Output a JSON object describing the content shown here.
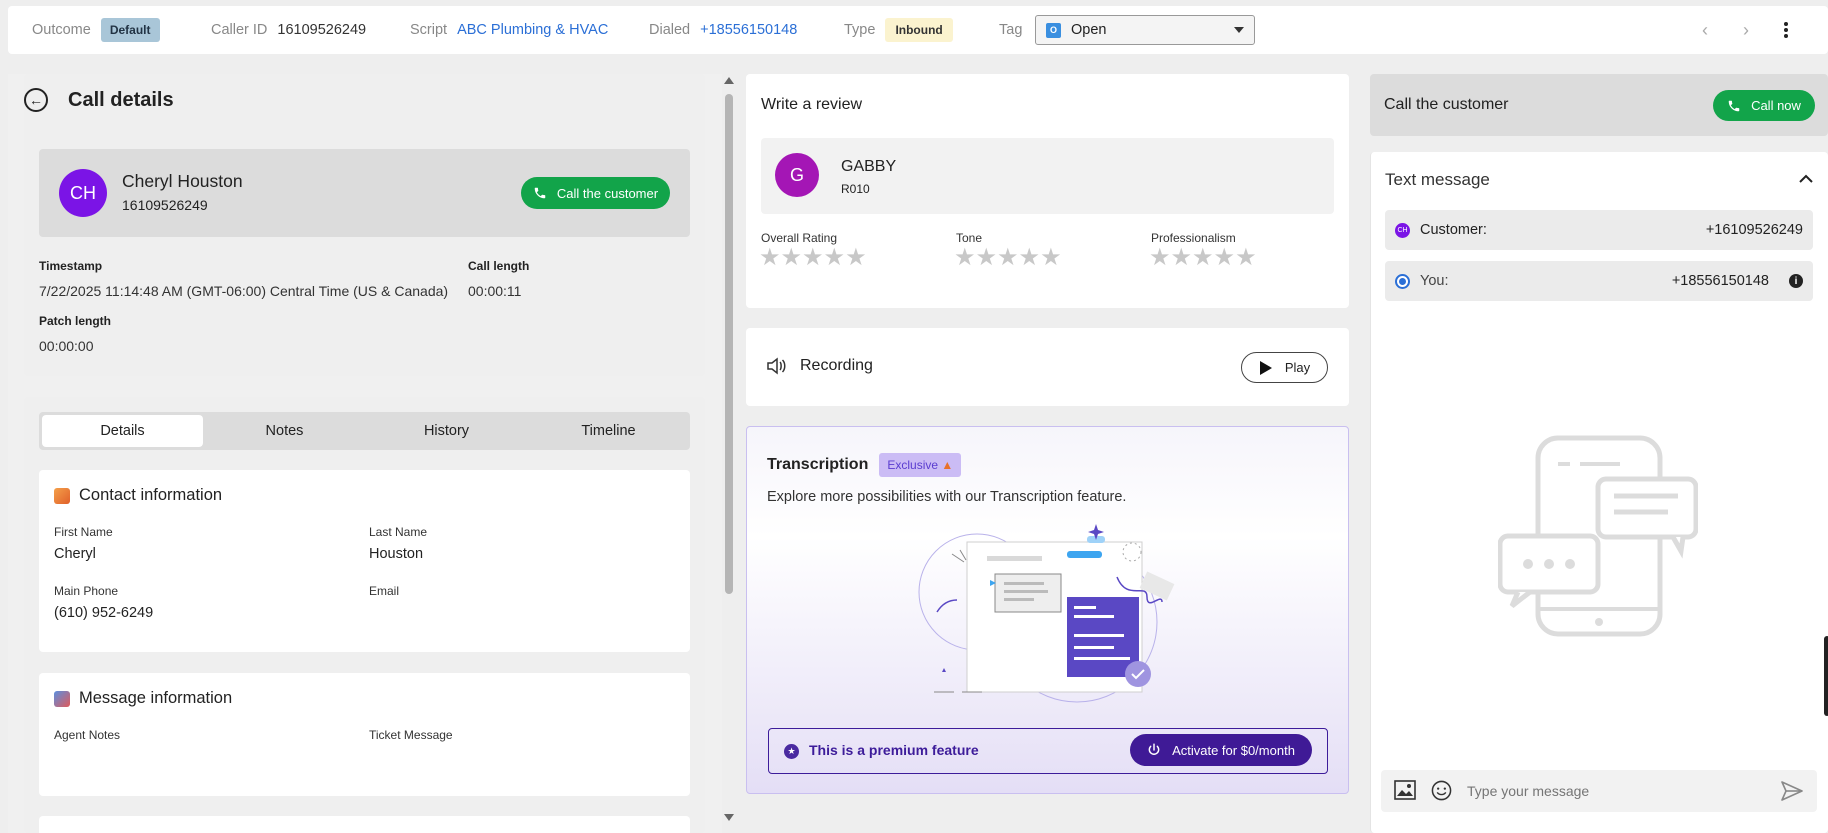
{
  "topbar": {
    "outcome_label": "Outcome",
    "outcome_value": "Default",
    "caller_id_label": "Caller ID",
    "caller_id_value": "16109526249",
    "script_label": "Script",
    "script_value": "ABC Plumbing & HVAC",
    "dialed_label": "Dialed",
    "dialed_value": "+18556150148",
    "type_label": "Type",
    "type_value": "Inbound",
    "tag_label": "Tag",
    "tag_initial": "O",
    "tag_value": "Open"
  },
  "call_details": {
    "title": "Call details",
    "contact_initials": "CH",
    "contact_name": "Cheryl Houston",
    "contact_phone": "16109526249",
    "call_button": "Call the customer",
    "timestamp_label": "Timestamp",
    "timestamp_value": "7/22/2025 11:14:48 AM (GMT-06:00) Central Time (US & Canada)",
    "call_length_label": "Call length",
    "call_length_value": "00:00:11",
    "patch_length_label": "Patch length",
    "patch_length_value": "00:00:00"
  },
  "tabs": [
    "Details",
    "Notes",
    "History",
    "Timeline"
  ],
  "contact_info": {
    "title": "Contact information",
    "first_name_label": "First Name",
    "first_name_value": "Cheryl",
    "last_name_label": "Last Name",
    "last_name_value": "Houston",
    "main_phone_label": "Main Phone",
    "main_phone_value": "(610) 952-6249",
    "email_label": "Email",
    "email_value": ""
  },
  "message_info": {
    "title": "Message information",
    "agent_notes_label": "Agent Notes",
    "ticket_message_label": "Ticket Message"
  },
  "review": {
    "title": "Write a review",
    "agent_initial": "G",
    "agent_name": "GABBY",
    "agent_code": "R010",
    "ratings": [
      {
        "label": "Overall Rating",
        "value": 0,
        "max": 5
      },
      {
        "label": "Tone",
        "value": 0,
        "max": 5
      },
      {
        "label": "Professionalism",
        "value": 0,
        "max": 5
      }
    ]
  },
  "recording": {
    "title": "Recording",
    "play_label": "Play"
  },
  "transcription": {
    "title": "Transcription",
    "badge": "Exclusive",
    "description": "Explore more possibilities with our Transcription feature.",
    "premium_text": "This is a premium feature",
    "activate_label": "Activate for $0/month"
  },
  "right": {
    "call_customer_label": "Call the customer",
    "call_now_label": "Call now",
    "text_message_title": "Text message",
    "customer_initials": "CH",
    "customer_label": "Customer:",
    "customer_number": "+16109526249",
    "you_label": "You:",
    "you_number": "+18556150148",
    "message_placeholder": "Type your message"
  },
  "colors": {
    "green": "#12a44a",
    "purple": "#3f1a96",
    "link_blue": "#2b6fd6",
    "avatar_ch": "#7b14e6",
    "avatar_g": "#a416b5"
  }
}
